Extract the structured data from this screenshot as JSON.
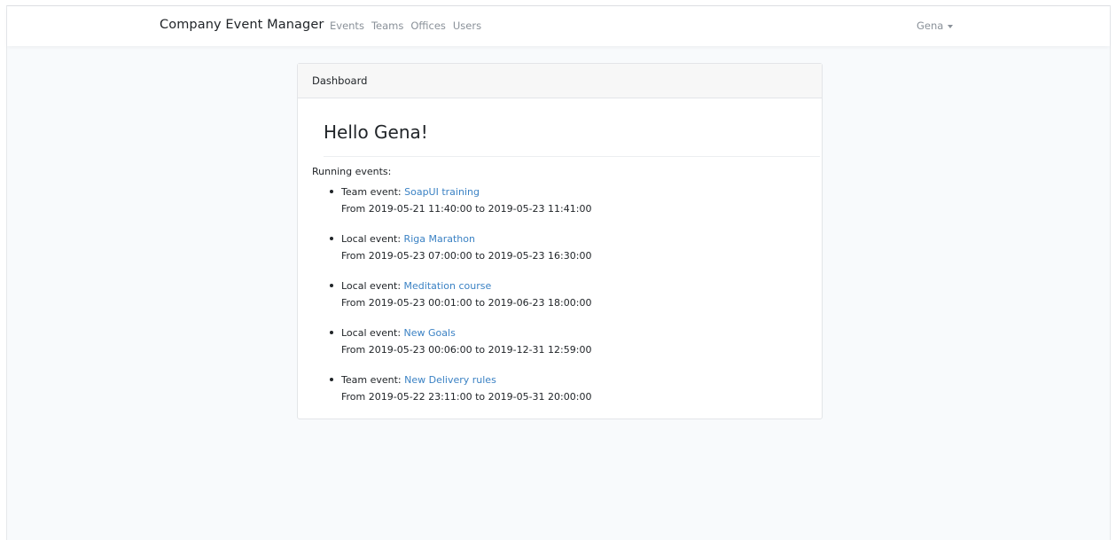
{
  "navbar": {
    "brand": "Company Event Manager",
    "links": [
      "Events",
      "Teams",
      "Offices",
      "Users"
    ],
    "user": "Gena"
  },
  "dashboard": {
    "header": "Dashboard",
    "greeting": "Hello Gena!",
    "running_label": "Running events:",
    "events": [
      {
        "type": "Team event:",
        "name": "SoapUI training",
        "range": "From 2019-05-21 11:40:00 to 2019-05-23 11:41:00"
      },
      {
        "type": "Local event:",
        "name": "Riga Marathon",
        "range": "From 2019-05-23 07:00:00 to 2019-05-23 16:30:00"
      },
      {
        "type": "Local event:",
        "name": "Meditation course",
        "range": "From 2019-05-23 00:01:00 to 2019-06-23 18:00:00"
      },
      {
        "type": "Local event:",
        "name": "New Goals",
        "range": "From 2019-05-23 00:06:00 to 2019-12-31 12:59:00"
      },
      {
        "type": "Team event:",
        "name": "New Delivery rules",
        "range": "From 2019-05-22 23:11:00 to 2019-05-31 20:00:00"
      }
    ]
  },
  "colors": {
    "link": "#3b82c4",
    "navlink": "#8a9199",
    "background": "#f8fafc"
  }
}
